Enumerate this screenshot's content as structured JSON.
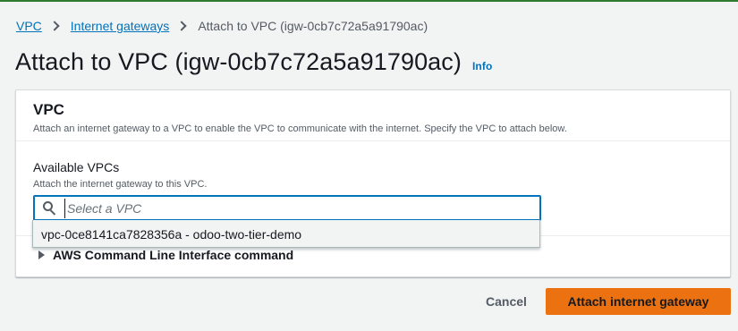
{
  "breadcrumb": {
    "items": [
      {
        "label": "VPC"
      },
      {
        "label": "Internet gateways"
      }
    ],
    "current": "Attach to VPC (igw-0cb7c72a5a91790ac)"
  },
  "header": {
    "title": "Attach to VPC (igw-0cb7c72a5a91790ac)",
    "info_label": "Info"
  },
  "panel": {
    "title": "VPC",
    "description": "Attach an internet gateway to a VPC to enable the VPC to communicate with the internet. Specify the VPC to attach below.",
    "field": {
      "label": "Available VPCs",
      "description": "Attach the internet gateway to this VPC.",
      "placeholder": "Select a VPC",
      "value": ""
    },
    "cli_section": "AWS Command Line Interface command"
  },
  "dropdown": {
    "options": [
      "vpc-0ce8141ca7828356a - odoo-two-tier-demo"
    ]
  },
  "footer": {
    "cancel_label": "Cancel",
    "submit_label": "Attach internet gateway"
  },
  "colors": {
    "link": "#0073bb",
    "primary_button": "#ec7211",
    "background": "#f2f3f3"
  },
  "icons": {
    "search": "search-icon",
    "expand": "caret-right-icon",
    "breadcrumb_separator": "chevron-right-icon"
  }
}
